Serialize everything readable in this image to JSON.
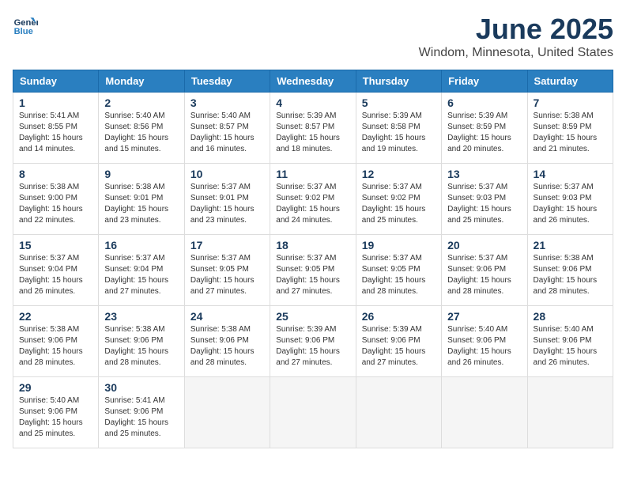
{
  "header": {
    "logo_line1": "General",
    "logo_line2": "Blue",
    "month": "June 2025",
    "location": "Windom, Minnesota, United States"
  },
  "weekdays": [
    "Sunday",
    "Monday",
    "Tuesday",
    "Wednesday",
    "Thursday",
    "Friday",
    "Saturday"
  ],
  "weeks": [
    [
      {
        "day": "1",
        "info": "Sunrise: 5:41 AM\nSunset: 8:55 PM\nDaylight: 15 hours\nand 14 minutes."
      },
      {
        "day": "2",
        "info": "Sunrise: 5:40 AM\nSunset: 8:56 PM\nDaylight: 15 hours\nand 15 minutes."
      },
      {
        "day": "3",
        "info": "Sunrise: 5:40 AM\nSunset: 8:57 PM\nDaylight: 15 hours\nand 16 minutes."
      },
      {
        "day": "4",
        "info": "Sunrise: 5:39 AM\nSunset: 8:57 PM\nDaylight: 15 hours\nand 18 minutes."
      },
      {
        "day": "5",
        "info": "Sunrise: 5:39 AM\nSunset: 8:58 PM\nDaylight: 15 hours\nand 19 minutes."
      },
      {
        "day": "6",
        "info": "Sunrise: 5:39 AM\nSunset: 8:59 PM\nDaylight: 15 hours\nand 20 minutes."
      },
      {
        "day": "7",
        "info": "Sunrise: 5:38 AM\nSunset: 8:59 PM\nDaylight: 15 hours\nand 21 minutes."
      }
    ],
    [
      {
        "day": "8",
        "info": "Sunrise: 5:38 AM\nSunset: 9:00 PM\nDaylight: 15 hours\nand 22 minutes."
      },
      {
        "day": "9",
        "info": "Sunrise: 5:38 AM\nSunset: 9:01 PM\nDaylight: 15 hours\nand 23 minutes."
      },
      {
        "day": "10",
        "info": "Sunrise: 5:37 AM\nSunset: 9:01 PM\nDaylight: 15 hours\nand 23 minutes."
      },
      {
        "day": "11",
        "info": "Sunrise: 5:37 AM\nSunset: 9:02 PM\nDaylight: 15 hours\nand 24 minutes."
      },
      {
        "day": "12",
        "info": "Sunrise: 5:37 AM\nSunset: 9:02 PM\nDaylight: 15 hours\nand 25 minutes."
      },
      {
        "day": "13",
        "info": "Sunrise: 5:37 AM\nSunset: 9:03 PM\nDaylight: 15 hours\nand 25 minutes."
      },
      {
        "day": "14",
        "info": "Sunrise: 5:37 AM\nSunset: 9:03 PM\nDaylight: 15 hours\nand 26 minutes."
      }
    ],
    [
      {
        "day": "15",
        "info": "Sunrise: 5:37 AM\nSunset: 9:04 PM\nDaylight: 15 hours\nand 26 minutes."
      },
      {
        "day": "16",
        "info": "Sunrise: 5:37 AM\nSunset: 9:04 PM\nDaylight: 15 hours\nand 27 minutes."
      },
      {
        "day": "17",
        "info": "Sunrise: 5:37 AM\nSunset: 9:05 PM\nDaylight: 15 hours\nand 27 minutes."
      },
      {
        "day": "18",
        "info": "Sunrise: 5:37 AM\nSunset: 9:05 PM\nDaylight: 15 hours\nand 27 minutes."
      },
      {
        "day": "19",
        "info": "Sunrise: 5:37 AM\nSunset: 9:05 PM\nDaylight: 15 hours\nand 28 minutes."
      },
      {
        "day": "20",
        "info": "Sunrise: 5:37 AM\nSunset: 9:06 PM\nDaylight: 15 hours\nand 28 minutes."
      },
      {
        "day": "21",
        "info": "Sunrise: 5:38 AM\nSunset: 9:06 PM\nDaylight: 15 hours\nand 28 minutes."
      }
    ],
    [
      {
        "day": "22",
        "info": "Sunrise: 5:38 AM\nSunset: 9:06 PM\nDaylight: 15 hours\nand 28 minutes."
      },
      {
        "day": "23",
        "info": "Sunrise: 5:38 AM\nSunset: 9:06 PM\nDaylight: 15 hours\nand 28 minutes."
      },
      {
        "day": "24",
        "info": "Sunrise: 5:38 AM\nSunset: 9:06 PM\nDaylight: 15 hours\nand 28 minutes."
      },
      {
        "day": "25",
        "info": "Sunrise: 5:39 AM\nSunset: 9:06 PM\nDaylight: 15 hours\nand 27 minutes."
      },
      {
        "day": "26",
        "info": "Sunrise: 5:39 AM\nSunset: 9:06 PM\nDaylight: 15 hours\nand 27 minutes."
      },
      {
        "day": "27",
        "info": "Sunrise: 5:40 AM\nSunset: 9:06 PM\nDaylight: 15 hours\nand 26 minutes."
      },
      {
        "day": "28",
        "info": "Sunrise: 5:40 AM\nSunset: 9:06 PM\nDaylight: 15 hours\nand 26 minutes."
      }
    ],
    [
      {
        "day": "29",
        "info": "Sunrise: 5:40 AM\nSunset: 9:06 PM\nDaylight: 15 hours\nand 25 minutes."
      },
      {
        "day": "30",
        "info": "Sunrise: 5:41 AM\nSunset: 9:06 PM\nDaylight: 15 hours\nand 25 minutes."
      },
      {
        "day": "",
        "info": ""
      },
      {
        "day": "",
        "info": ""
      },
      {
        "day": "",
        "info": ""
      },
      {
        "day": "",
        "info": ""
      },
      {
        "day": "",
        "info": ""
      }
    ]
  ]
}
